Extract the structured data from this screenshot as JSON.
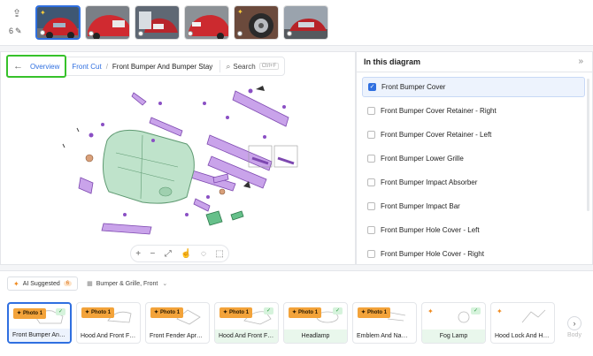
{
  "topbar": {
    "upload_icon": "upload-icon",
    "photo_count": "6",
    "thumbnails": [
      {
        "name": "photo-1",
        "active": true
      },
      {
        "name": "photo-2",
        "active": false
      },
      {
        "name": "photo-3",
        "active": false
      },
      {
        "name": "photo-4",
        "active": false
      },
      {
        "name": "photo-5",
        "active": false
      },
      {
        "name": "photo-6",
        "active": false
      }
    ]
  },
  "breadcrumb": {
    "back_icon": "arrow-left-icon",
    "overview": "Overview",
    "parent": "Front Cut",
    "current": "Front Bumper And Bumper Stay",
    "search_label": "Search",
    "search_shortcut": "Ctrl+F"
  },
  "diagram_toolbar": [
    "zoom-in-icon",
    "zoom-out-icon",
    "fit-icon",
    "pointer-icon",
    "lasso-icon",
    "select-box-icon"
  ],
  "list_panel": {
    "title": "In this diagram",
    "items": [
      {
        "label": "Front Bumper Cover",
        "checked": true
      },
      {
        "label": "Front Bumper Cover Retainer - Right",
        "checked": false
      },
      {
        "label": "Front Bumper Cover Retainer - Left",
        "checked": false
      },
      {
        "label": "Front Bumper Lower Grille",
        "checked": false
      },
      {
        "label": "Front Bumper Impact Absorber",
        "checked": false
      },
      {
        "label": "Front Bumper Impact Bar",
        "checked": false
      },
      {
        "label": "Front Bumper Hole Cover - Left",
        "checked": false
      },
      {
        "label": "Front Bumper Hole Cover - Right",
        "checked": false
      }
    ]
  },
  "suggestions": {
    "ai_label": "AI Suggested",
    "ai_count": "6",
    "group_label": "Bumper & Grille, Front",
    "cards": [
      {
        "label": "Front Bumper And ...",
        "badge": "Photo 1",
        "checked": true
      },
      {
        "label": "Hood And Front Fen...",
        "badge": "Photo 1",
        "checked": false
      },
      {
        "label": "Front Fender Apron ...",
        "badge": "Photo 1",
        "checked": false
      },
      {
        "label": "Hood And Front Fen...",
        "badge": "Photo 1",
        "checked": true
      },
      {
        "label": "Headlamp",
        "badge": "Photo 1",
        "checked": true
      },
      {
        "label": "Emblem And Name ...",
        "badge": "Photo 1",
        "checked": false
      },
      {
        "label": "Fog Lamp",
        "badge": "",
        "checked": true
      },
      {
        "label": "Hood Lock And Hinge",
        "badge": "",
        "checked": false
      }
    ],
    "next_icon": "chevron-right-icon",
    "overflow_label": "Body"
  },
  "colors": {
    "accent": "#2f6fe0",
    "highlight": "#36c22a",
    "badge": "#f3a33a",
    "part_purple": "#9b5fd0",
    "part_green": "#a9d6b8"
  }
}
